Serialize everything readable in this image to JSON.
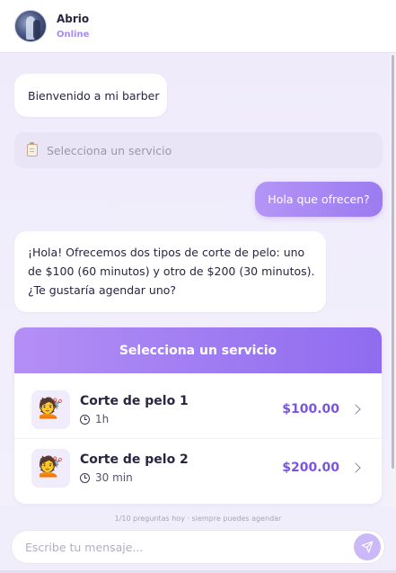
{
  "header": {
    "name": "Abrio",
    "status": "Online",
    "avatar_icon": "photo-avatar"
  },
  "messages": {
    "welcome": "Bienvenido a mi barber",
    "service_picker_placeholder": "Selecciona un servicio",
    "service_picker_icon": "clipboard-icon",
    "user_message": "Hola que ofrecen?",
    "bot_reply": "¡Hola! Ofrecemos dos tipos de corte de pelo: uno de $100 (60 minutos) y otro de $200 (30 minutos). ¿Te gustaría agendar uno?"
  },
  "service_card": {
    "title": "Selecciona un servicio",
    "services": [
      {
        "name": "Corte de pelo 1",
        "duration": "1h",
        "price": "$100.00",
        "icon": "haircut-person-icon"
      },
      {
        "name": "Corte de pelo 2",
        "duration": "30 min",
        "price": "$200.00",
        "icon": "haircut-person-icon"
      }
    ]
  },
  "footer": {
    "note": "1/10 preguntas hoy · siempre puedes agendar",
    "input_placeholder": "Escribe tu mensaje...",
    "send_icon": "paper-plane-icon"
  },
  "colors": {
    "accent": "#9c7bf0",
    "accent_light": "#b495f6",
    "price": "#7a56e0",
    "status": "#a88af0"
  }
}
